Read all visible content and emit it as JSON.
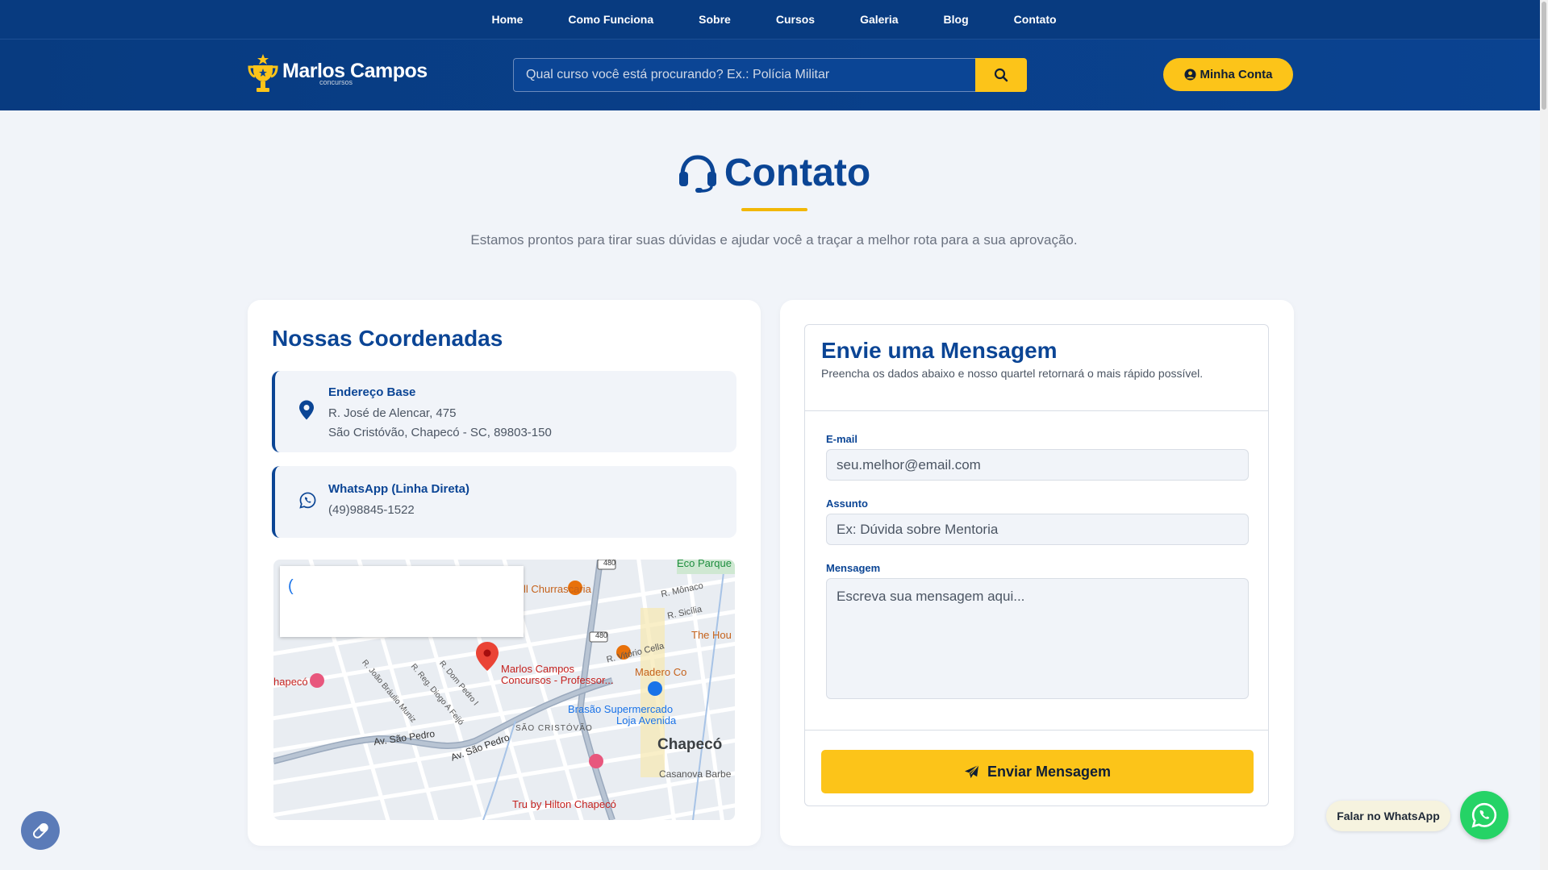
{
  "nav": {
    "items": [
      "Home",
      "Como Funciona",
      "Sobre",
      "Cursos",
      "Galeria",
      "Blog",
      "Contato"
    ]
  },
  "header": {
    "logo_text": "Marlos Campos",
    "logo_sub": "concursos",
    "search_placeholder": "Qual curso você está procurando? Ex.: Polícia Militar",
    "account_label": "Minha Conta"
  },
  "hero": {
    "title": "Contato",
    "subtitle": "Estamos prontos para tirar suas dúvidas e ajudar você a traçar a melhor rota para a sua aprovação."
  },
  "coords": {
    "title": "Nossas Coordenadas",
    "address_label": "Endereço Base",
    "address_line1": "R. José de Alencar, 475",
    "address_line2": "São Cristóvão, Chapecó - SC, 89803-150",
    "whatsapp_label": "WhatsApp (Linha Direta)",
    "whatsapp_value": "(49)98845-1522"
  },
  "map": {
    "popup_text": "(",
    "labels": {
      "eco": "Eco Parque",
      "churrascaria": "ll Churrascaria",
      "monaco": "R. Mônaco",
      "sicilia": "R. Sicília",
      "house": "The Hou",
      "vitorio": "R. Vitório Cella",
      "pin_name1": "Marlos Campos",
      "pin_name2": "Concursos - Professor...",
      "madero": "Madero Co",
      "chapeco_left": "hapecó",
      "brasao1": "Brasão Supermercado",
      "brasao2": "Loja Avenida",
      "sao_cristovao": "SÃO CRISTÓVÃO",
      "chapeco": "Chapecó",
      "av_sao_pedro1": "Av. São Pedro",
      "av_sao_pedro2": "Av. São Pedro",
      "casanova": "Casanova Barbe",
      "tru": "Tru by Hilton Chapecó",
      "dom_pedro": "R. Dom Pedro I",
      "diogo": "R. Reg. Diogo A Feijó",
      "braulio": "R. João Bráulio Muniz",
      "r480a": "480",
      "r480b": "480"
    }
  },
  "form": {
    "title": "Envie uma Mensagem",
    "description": "Preencha os dados abaixo e nosso quartel retornará o mais rápido possível.",
    "email_label": "E-mail",
    "email_placeholder": "seu.melhor@email.com",
    "subject_label": "Assunto",
    "subject_placeholder": "Ex: Dúvida sobre Mentoria",
    "message_label": "Mensagem",
    "message_placeholder": "Escreva sua mensagem aqui...",
    "submit_label": "Enviar Mensagem"
  },
  "floating": {
    "whatsapp_label": "Falar no WhatsApp"
  },
  "colors": {
    "primary": "#0b4595",
    "accent": "#fcc419",
    "whatsapp": "#25d366"
  }
}
